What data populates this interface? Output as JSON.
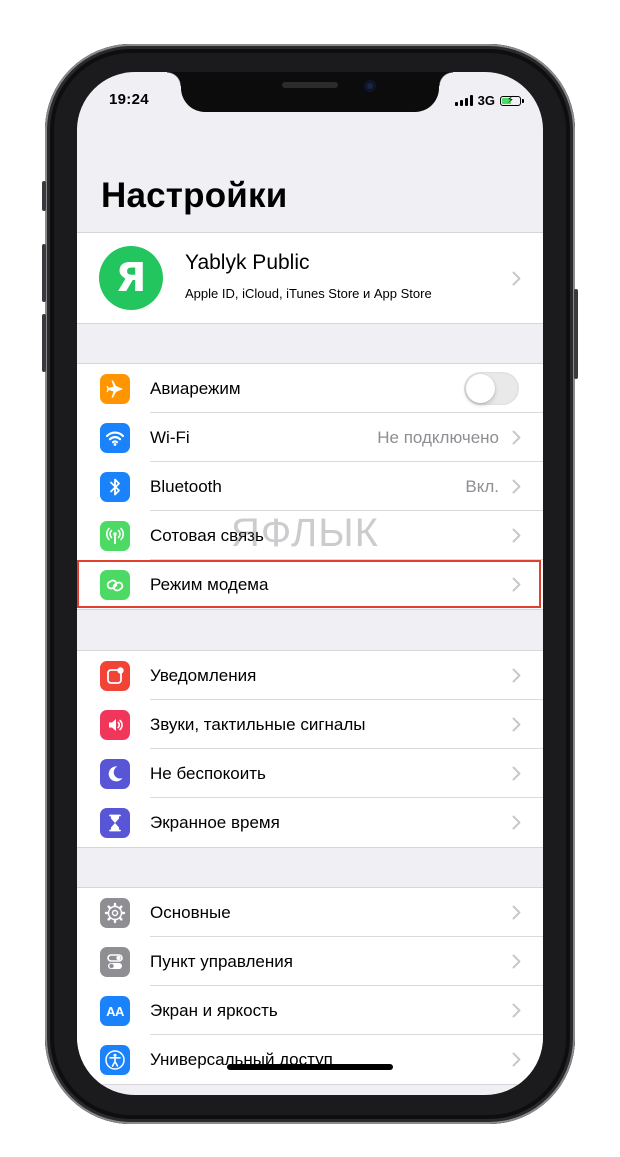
{
  "status_bar": {
    "time": "19:24",
    "network": "3G"
  },
  "title": "Настройки",
  "profile": {
    "avatar_letter": "Я",
    "name": "Yablyk Public",
    "subtitle": "Apple ID, iCloud, iTunes Store и App Store",
    "avatar_color": "#22c55e"
  },
  "groups": {
    "connectivity": [
      {
        "label": "Авиарежим",
        "icon": "airplane-icon",
        "color": "#ff9500",
        "toggle": false
      },
      {
        "label": "Wi-Fi",
        "icon": "wifi-icon",
        "color": "#1a82fb",
        "value": "Не подключено"
      },
      {
        "label": "Bluetooth",
        "icon": "bluetooth-icon",
        "color": "#1a82fb",
        "value": "Вкл."
      },
      {
        "label": "Сотовая связь",
        "icon": "antenna-icon",
        "color": "#4cd964"
      },
      {
        "label": "Режим модема",
        "icon": "chain-link-icon",
        "color": "#4cd964",
        "highlighted": true
      }
    ],
    "notifications": [
      {
        "label": "Уведомления",
        "icon": "notifications-icon",
        "color": "#f14336"
      },
      {
        "label": "Звуки, тактильные сигналы",
        "icon": "speaker-icon",
        "color": "#f0365a"
      },
      {
        "label": "Не беспокоить",
        "icon": "moon-icon",
        "color": "#5856d6"
      },
      {
        "label": "Экранное время",
        "icon": "hourglass-icon",
        "color": "#5856d6"
      }
    ],
    "general": [
      {
        "label": "Основные",
        "icon": "gear-icon",
        "color": "#8e8e93"
      },
      {
        "label": "Пункт управления",
        "icon": "switches-icon",
        "color": "#8e8e93"
      },
      {
        "label": "Экран и яркость",
        "icon": "aa-text-icon",
        "color": "#1a82fb",
        "icon_text": "AA"
      },
      {
        "label": "Универсальный доступ",
        "icon": "accessibility-icon",
        "color": "#1a82fb"
      }
    ]
  },
  "watermark": "ЯФЛЫК",
  "highlight_color": "#e0412f"
}
